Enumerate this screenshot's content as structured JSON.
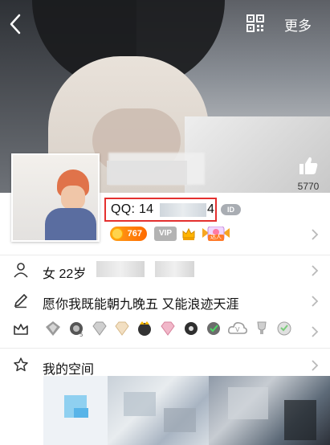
{
  "header": {
    "more_label": "更多",
    "icons": [
      "back-icon",
      "qr-code-icon"
    ]
  },
  "like": {
    "count": "5770",
    "icon": "thumbs-up-icon"
  },
  "profile": {
    "qq_label": "QQ: 14",
    "qq_tail": "4",
    "id_badge": "ID",
    "level_badge": "767",
    "vip_badge": "VIP",
    "star_badge_text": "达人"
  },
  "info": {
    "gender_age": "女  22岁",
    "signature": "愿你我既能朝九晚五 又能浪迹天涯",
    "space_label": "我的空间"
  },
  "colors": {
    "highlight_box": "#e4302f",
    "level_badge": "#ff8a00",
    "vip_badge": "#b3b3b3",
    "divider": "#ebebeb"
  }
}
